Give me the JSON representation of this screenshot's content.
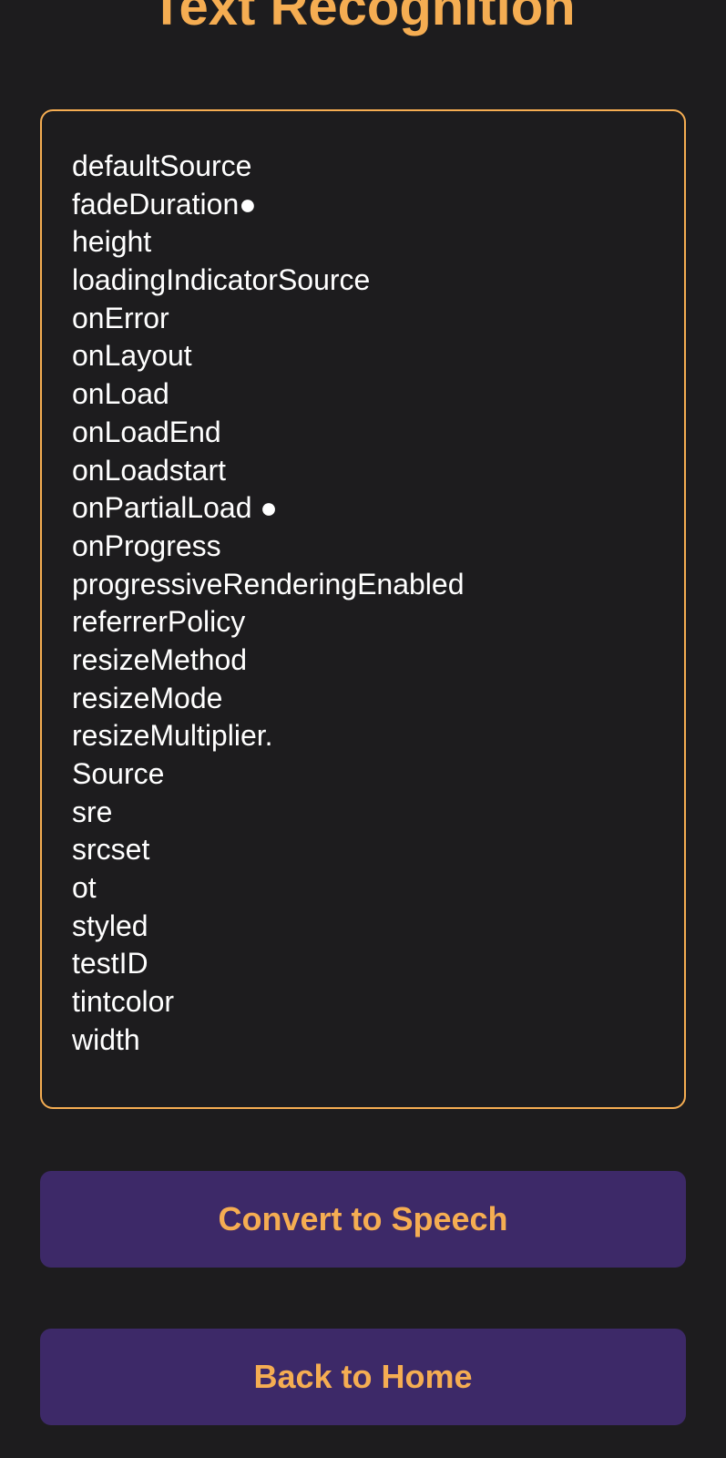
{
  "colors": {
    "background": "#1d1c1e",
    "accent": "#f5ad52",
    "button_bg": "#3d2968",
    "text": "#ffffff"
  },
  "header": {
    "title": "Text Recognition"
  },
  "result": {
    "lines": [
      "defaultSource",
      "fadeDuration●",
      "height",
      "loadingIndicatorSource",
      "onError",
      "onLayout",
      "onLoad",
      "onLoadEnd",
      "onLoadstart",
      "onPartialLoad ●",
      "onProgress",
      "progressiveRenderingEnabled",
      "referrerPolicy",
      "resizeMethod",
      "resizeMode",
      "resizeMultiplier.",
      "Source",
      "sre",
      "srcset",
      "ot",
      "styled",
      "testID",
      "tintcolor",
      "width"
    ]
  },
  "actions": {
    "convert_label": "Convert to Speech",
    "home_label": "Back to Home"
  }
}
